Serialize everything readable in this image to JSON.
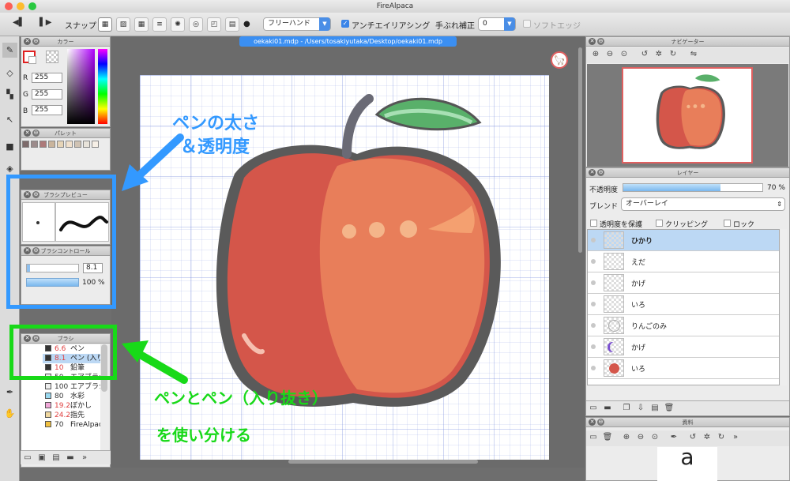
{
  "app": {
    "title": "FireAlpaca"
  },
  "toolbar": {
    "snap_label": "スナップ",
    "mode_select": "フリーハンド",
    "antialias_label": "アンチエイリアシング",
    "stabilizer_label": "手ぶれ補正",
    "stabilizer_value": "0",
    "soft_edge_label": "ソフトエッジ"
  },
  "color_panel": {
    "title": "カラー",
    "r_label": "R",
    "g_label": "G",
    "b_label": "B",
    "r": "255",
    "g": "255",
    "b": "255"
  },
  "palette_panel": {
    "title": "パレット",
    "swatches": [
      "#7d6b6b",
      "#9c8b8b",
      "#ad7a7a",
      "#c9b49c",
      "#e6d4b7",
      "#f0e0cc",
      "#cfc2b3",
      "#e8e3da",
      "#f6efe6"
    ]
  },
  "brush_preview": {
    "title": "ブラシプレビュー"
  },
  "brush_control": {
    "title": "ブラシコントロール",
    "size": "8.1",
    "opacity": "100 %"
  },
  "brush_panel": {
    "title": "ブラシ",
    "items": [
      {
        "size": "6.6",
        "name": "ペン",
        "color": "#333333",
        "selected": false
      },
      {
        "size": "8.1",
        "name": "ペン (入り抜き)",
        "color": "#333333",
        "selected": true
      },
      {
        "size": "10",
        "name": "鉛筆",
        "color": "#333333",
        "selected": false
      },
      {
        "size": "50",
        "name": "エアブラシ",
        "color": "#eeeeee",
        "selected": false
      },
      {
        "size": "100",
        "name": "エアブラシ",
        "color": "#eeeeee",
        "selected": false
      },
      {
        "size": "80",
        "name": "水彩",
        "color": "#9ad9f0",
        "selected": false
      },
      {
        "size": "19.2",
        "name": "ぼかし",
        "color": "#f0a8d8",
        "selected": false
      },
      {
        "size": "24.2",
        "name": "指先",
        "color": "#f0d8a0",
        "selected": false
      },
      {
        "size": "70",
        "name": "FireAlpaca",
        "color": "#f0c040",
        "selected": false
      }
    ]
  },
  "document": {
    "tab": "oekaki01.mdp - /Users/tosakiyutaka/Desktop/oekaki01.mdp"
  },
  "annotations": {
    "blue_line1": "ペンの太さ",
    "blue_line2": "＆透明度",
    "green_line1": "ペンとペン（入り抜き）",
    "green_line2": "を使い分ける"
  },
  "navigator": {
    "title": "ナビゲーター"
  },
  "layer_panel": {
    "title": "レイヤー",
    "opacity_label": "不透明度",
    "opacity_value": "70 %",
    "opacity": 0.7,
    "blend_label": "ブレンド",
    "blend_value": "オーバーレイ",
    "protect_label": "透明度を保護",
    "clipping_label": "クリッピング",
    "lock_label": "ロック",
    "layers": [
      {
        "name": "ひかり",
        "selected": true
      },
      {
        "name": "えだ",
        "selected": false
      },
      {
        "name": "かげ",
        "selected": false
      },
      {
        "name": "いろ",
        "selected": false
      },
      {
        "name": "りんごのみ",
        "selected": false
      },
      {
        "name": "かげ",
        "selected": false
      },
      {
        "name": "いろ",
        "selected": false
      }
    ]
  },
  "materials_panel": {
    "title": "資料",
    "preview_char": "a"
  },
  "colors": {
    "accent_blue": "#3399ff",
    "accent_green": "#18d918",
    "selection": "#bcd8f4",
    "apple_red": "#d4564a",
    "apple_orange": "#e87e5a"
  }
}
